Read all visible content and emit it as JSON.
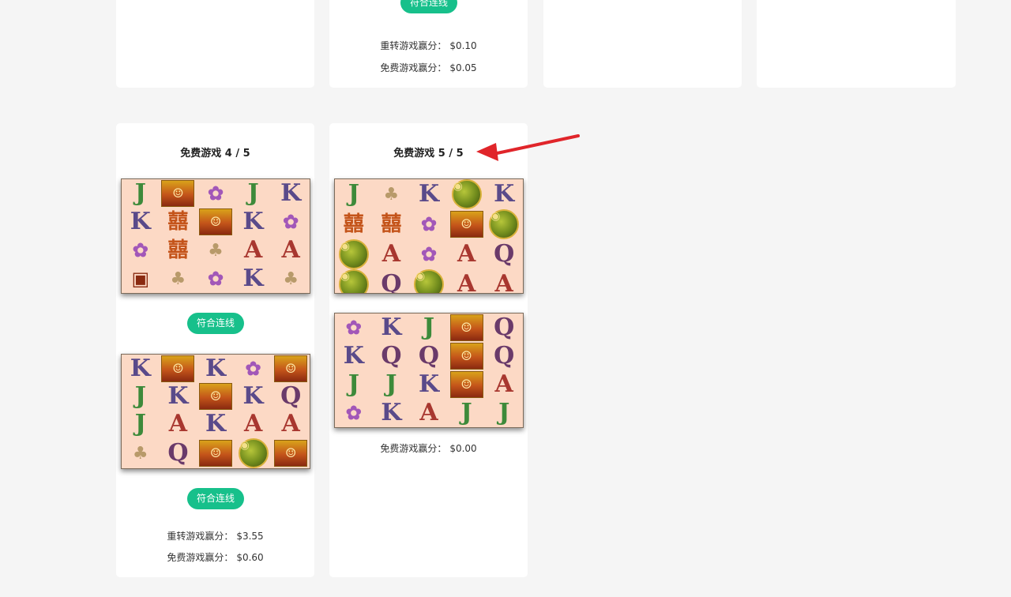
{
  "top_card": {
    "badge": "符合连线",
    "respin_label": "重转游戏赢分：",
    "respin_value": "$0.10",
    "free_label": "免费游戏赢分：",
    "free_value": "$0.05"
  },
  "card_4": {
    "title": "免费游戏 4 / 5",
    "badge_1": "符合连线",
    "badge_2": "符合连线",
    "respin_label": "重转游戏赢分：",
    "respin_value": "$3.55",
    "free_label": "免费游戏赢分：",
    "free_value": "$0.60"
  },
  "card_5": {
    "title": "免费游戏 5 / 5",
    "free_label": "免费游戏赢分：",
    "free_value": "$0.00"
  },
  "boards": {
    "card4_top": [
      [
        "J",
        "pic",
        "flower",
        "J",
        "K"
      ],
      [
        "K",
        "emblem",
        "pic",
        "K",
        "flower"
      ],
      [
        "flower",
        "emblem",
        "bag",
        "A",
        "A"
      ],
      [
        "chest",
        "bag",
        "flower",
        "K",
        "bag"
      ]
    ],
    "card4_bottom": [
      [
        "K",
        "pic",
        "K",
        "flower",
        "pic"
      ],
      [
        "J",
        "K",
        "pic",
        "K",
        "Q"
      ],
      [
        "J",
        "A",
        "K",
        "A",
        "A"
      ],
      [
        "bag",
        "Q",
        "pic",
        "coin",
        "pic"
      ]
    ],
    "card5_top": [
      [
        "J",
        "bag",
        "K",
        "coin",
        "K"
      ],
      [
        "emblem",
        "emblem",
        "flower",
        "pic",
        "coin"
      ],
      [
        "coin",
        "A",
        "flower",
        "A",
        "Q"
      ],
      [
        "coin",
        "Q",
        "coin",
        "A",
        "A"
      ]
    ],
    "card5_bottom": [
      [
        "flower",
        "K",
        "J",
        "pic",
        "Q"
      ],
      [
        "K",
        "Q",
        "Q",
        "pic",
        "Q"
      ],
      [
        "J",
        "J",
        "K",
        "pic",
        "A"
      ],
      [
        "flower",
        "K",
        "A",
        "J",
        "J"
      ]
    ]
  },
  "symbol_glyphs": {
    "pic": "☺",
    "coin": "◉",
    "emblem": "囍",
    "flower": "✿",
    "bag": "♣",
    "chest": "▣"
  },
  "colors": {
    "accent": "#17c08b",
    "arrow": "#e0252a",
    "board_bg": "#fcd9c5"
  }
}
